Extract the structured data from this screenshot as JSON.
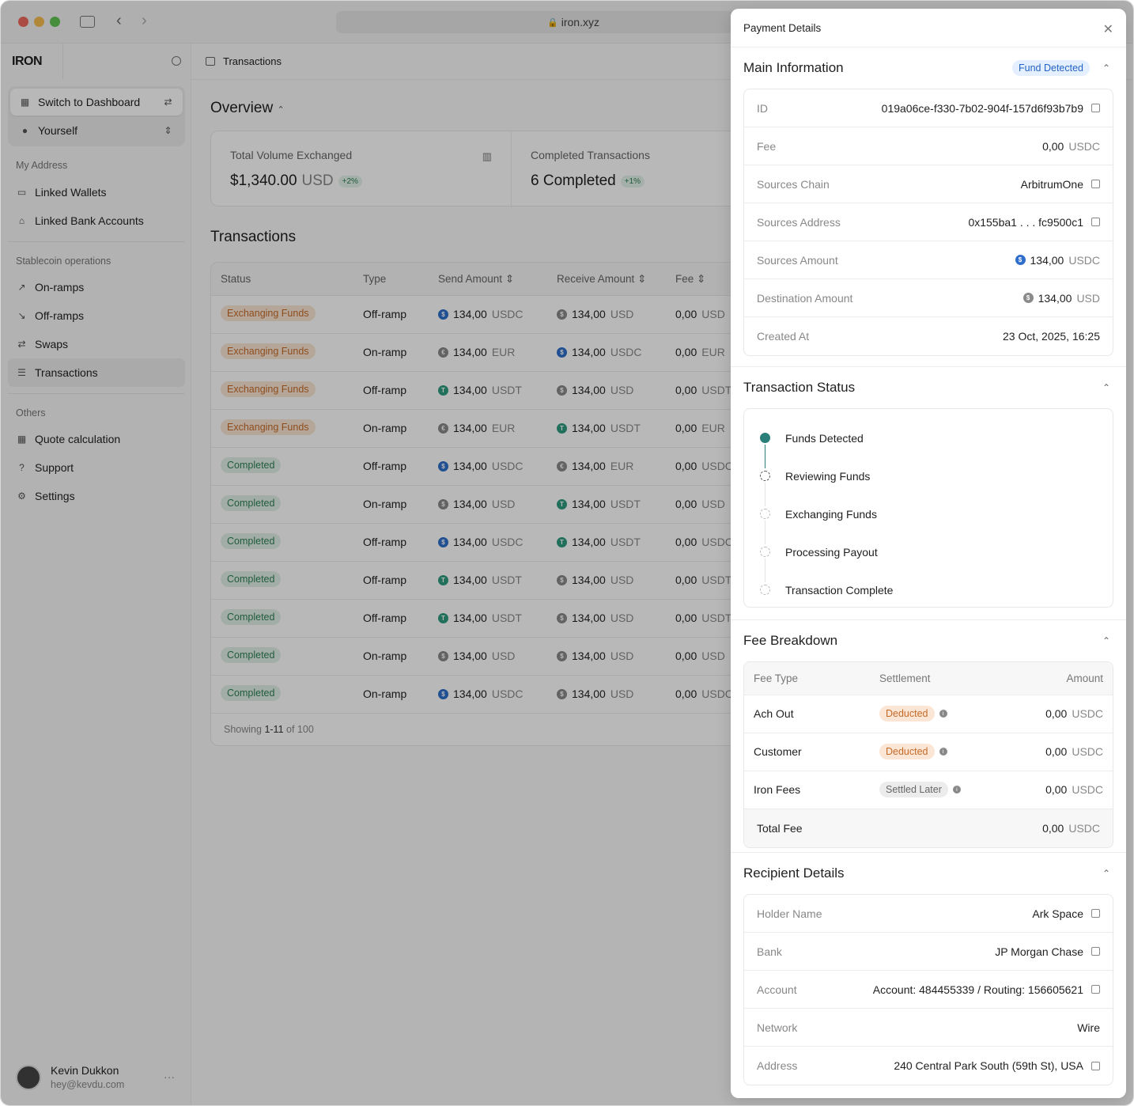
{
  "browser": {
    "url": "iron.xyz"
  },
  "brand": {
    "logo": "IRON"
  },
  "sidebar": {
    "switch_label": "Switch to Dashboard",
    "account_label": "Yourself",
    "section_address": "My Address",
    "items_address": [
      {
        "label": "Linked Wallets",
        "icon": "wallet-icon"
      },
      {
        "label": "Linked Bank Accounts",
        "icon": "bank-icon"
      }
    ],
    "section_ops": "Stablecoin operations",
    "items_ops": [
      {
        "label": "On-ramps",
        "icon": "arrow-up-right-icon"
      },
      {
        "label": "Off-ramps",
        "icon": "arrow-down-right-icon"
      },
      {
        "label": "Swaps",
        "icon": "swap-icon"
      },
      {
        "label": "Transactions",
        "icon": "list-icon"
      }
    ],
    "section_others": "Others",
    "items_others": [
      {
        "label": "Quote calculation",
        "icon": "calculator-icon"
      },
      {
        "label": "Support",
        "icon": "help-icon"
      },
      {
        "label": "Settings",
        "icon": "gear-icon"
      }
    ],
    "user": {
      "name": "Kevin Dukkon",
      "email": "hey@kevdu.com"
    }
  },
  "main": {
    "breadcrumb": "Transactions",
    "overview_title": "Overview",
    "stats": [
      {
        "label": "Total Volume Exchanged",
        "value": "$1,340.00",
        "unit": "USD",
        "delta": "+2%"
      },
      {
        "label": "Completed Transactions",
        "value": "6 Completed",
        "unit": "",
        "delta": "+1%"
      }
    ],
    "transactions_title": "Transactions",
    "columns": [
      "Status",
      "Type",
      "Send Amount",
      "Receive Amount",
      "Fee"
    ],
    "rows": [
      {
        "status": "Exchanging Funds",
        "kind": "ex",
        "type": "Off-ramp",
        "send": "134,00",
        "send_cur": "USDC",
        "recv": "134,00",
        "recv_cur": "USD",
        "fee": "0,00",
        "fee_cur": "USD"
      },
      {
        "status": "Exchanging Funds",
        "kind": "ex",
        "type": "On-ramp",
        "send": "134,00",
        "send_cur": "EUR",
        "recv": "134,00",
        "recv_cur": "USDC",
        "fee": "0,00",
        "fee_cur": "EUR"
      },
      {
        "status": "Exchanging Funds",
        "kind": "ex",
        "type": "Off-ramp",
        "send": "134,00",
        "send_cur": "USDT",
        "recv": "134,00",
        "recv_cur": "USD",
        "fee": "0,00",
        "fee_cur": "USDT"
      },
      {
        "status": "Exchanging Funds",
        "kind": "ex",
        "type": "On-ramp",
        "send": "134,00",
        "send_cur": "EUR",
        "recv": "134,00",
        "recv_cur": "USDT",
        "fee": "0,00",
        "fee_cur": "EUR"
      },
      {
        "status": "Completed",
        "kind": "co",
        "type": "Off-ramp",
        "send": "134,00",
        "send_cur": "USDC",
        "recv": "134,00",
        "recv_cur": "EUR",
        "fee": "0,00",
        "fee_cur": "USDC"
      },
      {
        "status": "Completed",
        "kind": "co",
        "type": "On-ramp",
        "send": "134,00",
        "send_cur": "USD",
        "recv": "134,00",
        "recv_cur": "USDT",
        "fee": "0,00",
        "fee_cur": "USD"
      },
      {
        "status": "Completed",
        "kind": "co",
        "type": "Off-ramp",
        "send": "134,00",
        "send_cur": "USDC",
        "recv": "134,00",
        "recv_cur": "USDT",
        "fee": "0,00",
        "fee_cur": "USDC"
      },
      {
        "status": "Completed",
        "kind": "co",
        "type": "Off-ramp",
        "send": "134,00",
        "send_cur": "USDT",
        "recv": "134,00",
        "recv_cur": "USD",
        "fee": "0,00",
        "fee_cur": "USDT"
      },
      {
        "status": "Completed",
        "kind": "co",
        "type": "Off-ramp",
        "send": "134,00",
        "send_cur": "USDT",
        "recv": "134,00",
        "recv_cur": "USD",
        "fee": "0,00",
        "fee_cur": "USDT"
      },
      {
        "status": "Completed",
        "kind": "co",
        "type": "On-ramp",
        "send": "134,00",
        "send_cur": "USD",
        "recv": "134,00",
        "recv_cur": "USD",
        "fee": "0,00",
        "fee_cur": "USD"
      },
      {
        "status": "Completed",
        "kind": "co",
        "type": "On-ramp",
        "send": "134,00",
        "send_cur": "USDC",
        "recv": "134,00",
        "recv_cur": "USD",
        "fee": "0,00",
        "fee_cur": "USDC"
      }
    ],
    "footer_prefix": "Showing",
    "footer_range": "1-11",
    "footer_suffix": "of 100"
  },
  "panel": {
    "title": "Payment Details",
    "main_title": "Main Information",
    "main_badge": "Fund Detected",
    "main_fields": [
      {
        "k": "ID",
        "v": "019a06ce-f330-7b02-904f-157d6f93b7b9",
        "unit": "",
        "copy": true,
        "coin": ""
      },
      {
        "k": "Fee",
        "v": "0,00",
        "unit": "USDC",
        "copy": false,
        "coin": ""
      },
      {
        "k": "Sources Chain",
        "v": "ArbitrumOne",
        "unit": "",
        "copy": true,
        "coin": ""
      },
      {
        "k": "Sources Address",
        "v": "0x155ba1 . . . fc9500c1",
        "unit": "",
        "copy": true,
        "coin": ""
      },
      {
        "k": "Sources Amount",
        "v": "134,00",
        "unit": "USDC",
        "copy": false,
        "coin": "USDC"
      },
      {
        "k": "Destination Amount",
        "v": "134,00",
        "unit": "USD",
        "copy": false,
        "coin": "USD"
      },
      {
        "k": "Created At",
        "v": "23 Oct, 2025, 16:25",
        "unit": "",
        "copy": false,
        "coin": ""
      }
    ],
    "status_title": "Transaction Status",
    "steps": [
      "Funds Detected",
      "Reviewing Funds",
      "Exchanging Funds",
      "Processing Payout",
      "Transaction Complete"
    ],
    "fee_title": "Fee Breakdown",
    "fee_cols": [
      "Fee Type",
      "Settlement",
      "Amount"
    ],
    "fee_rows": [
      {
        "type": "Ach Out",
        "settle": "Deducted",
        "kind": "de",
        "amt": "0,00",
        "cur": "USDC"
      },
      {
        "type": "Customer",
        "settle": "Deducted",
        "kind": "de",
        "amt": "0,00",
        "cur": "USDC"
      },
      {
        "type": "Iron Fees",
        "settle": "Settled Later",
        "kind": "sl",
        "amt": "0,00",
        "cur": "USDC"
      }
    ],
    "fee_total_label": "Total Fee",
    "fee_total": "0,00",
    "fee_total_cur": "USDC",
    "recipient_title": "Recipient Details",
    "recipient_fields": [
      {
        "k": "Holder Name",
        "v": "Ark Space",
        "copy": true
      },
      {
        "k": "Bank",
        "v": "JP Morgan Chase",
        "copy": true
      },
      {
        "k": "Account",
        "v": "Account: 484455339 / Routing: 156605621",
        "copy": true
      },
      {
        "k": "Network",
        "v": "Wire",
        "copy": false
      },
      {
        "k": "Address",
        "v": "240 Central Park South (59th St), USA",
        "copy": true
      }
    ]
  },
  "colors": {
    "usdc": "#2f6fcb",
    "usdt": "#2e9c7e",
    "usd": "#8a8a8a",
    "eur": "#8a8a8a",
    "accent": "#2a7f78"
  }
}
